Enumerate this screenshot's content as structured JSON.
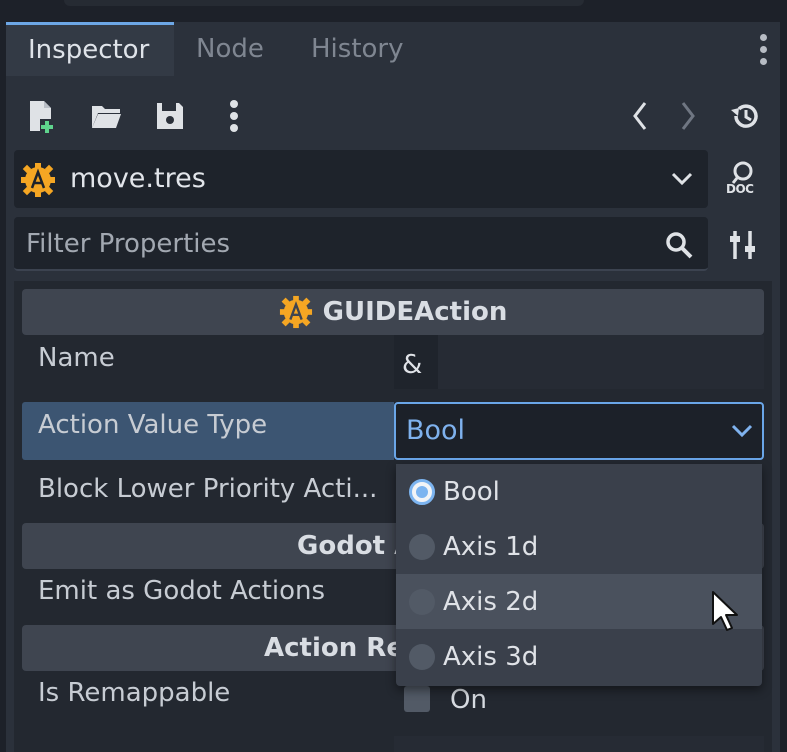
{
  "tabs": [
    {
      "label": "Inspector",
      "active": true
    },
    {
      "label": "Node",
      "active": false
    },
    {
      "label": "History",
      "active": false
    }
  ],
  "toolbar": {
    "icons": [
      "new-resource-icon",
      "open-folder-icon",
      "save-icon",
      "more-menu-icon",
      "back-arrow-icon",
      "forward-arrow-icon",
      "history-icon"
    ]
  },
  "resource": {
    "name": "move.tres",
    "doc_label": "DOC"
  },
  "filter": {
    "placeholder": "Filter Properties"
  },
  "inspector": {
    "class_name": "GUIDEAction",
    "sections": {
      "godot_actions": "Godot A",
      "action_remapping": "Action Re"
    },
    "properties": {
      "name_label": "Name",
      "name_value": "&",
      "value_type_label": "Action Value Type",
      "value_type_selected": "Bool",
      "block_lower_label": "Block Lower Priority Acti...",
      "emit_label": "Emit as Godot Actions",
      "remappable_label": "Is Remappable",
      "remappable_value": "On"
    }
  },
  "dropdown": {
    "options": [
      {
        "label": "Bool",
        "selected": true
      },
      {
        "label": "Axis 1d",
        "selected": false
      },
      {
        "label": "Axis 2d",
        "selected": false,
        "hovered": true
      },
      {
        "label": "Axis 3d",
        "selected": false
      }
    ]
  },
  "colors": {
    "accent": "#6aa6e8",
    "godot_orange": "#f5a623",
    "panel": "#2b313b",
    "highlight_row": "#3c5572"
  }
}
